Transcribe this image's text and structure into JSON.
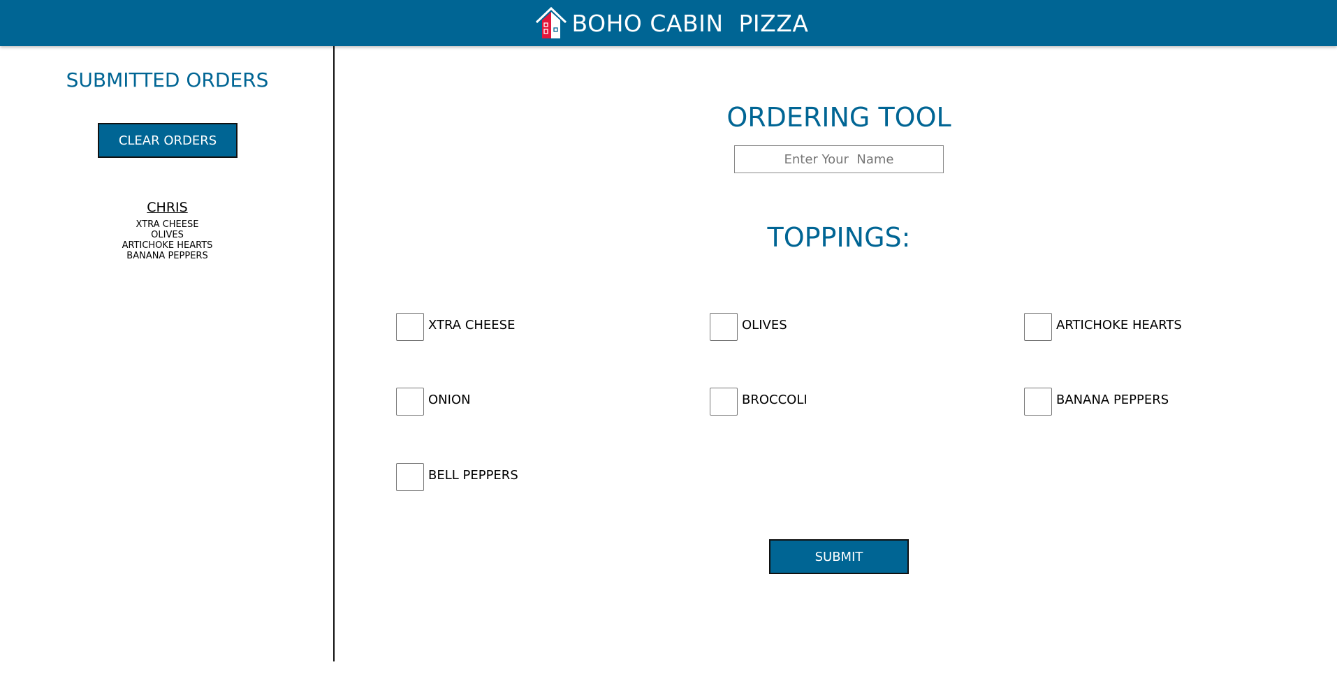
{
  "header": {
    "title": "BOHO CABIN  PIZZA",
    "logo_icon": "house-icon",
    "background_color": "#006594"
  },
  "sidebar": {
    "title": "SUBMITTED ORDERS",
    "clear_label": "CLEAR ORDERS",
    "orders": [
      {
        "name": "CHRIS",
        "toppings": [
          "XTRA CHEESE",
          "OLIVES",
          "ARTICHOKE  HEARTS",
          "BANANA  PEPPERS"
        ]
      }
    ]
  },
  "main": {
    "title": "ORDERING TOOL",
    "name_input": {
      "placeholder": "Enter Your  Name",
      "value": ""
    },
    "toppings_title": "TOPPINGS:",
    "toppings": [
      {
        "label": "XTRA CHEESE",
        "checked": false
      },
      {
        "label": "OLIVES",
        "checked": false
      },
      {
        "label": "ARTICHOKE  HEARTS",
        "checked": false
      },
      {
        "label": "ONION",
        "checked": false
      },
      {
        "label": "BROCCOLI",
        "checked": false
      },
      {
        "label": "BANANA  PEPPERS",
        "checked": false
      },
      {
        "label": "BELL  PEPPERS",
        "checked": false
      }
    ],
    "submit_label": "SUBMIT"
  },
  "colors": {
    "accent": "#006594",
    "logo_red": "#e3173b",
    "text": "#000000"
  }
}
